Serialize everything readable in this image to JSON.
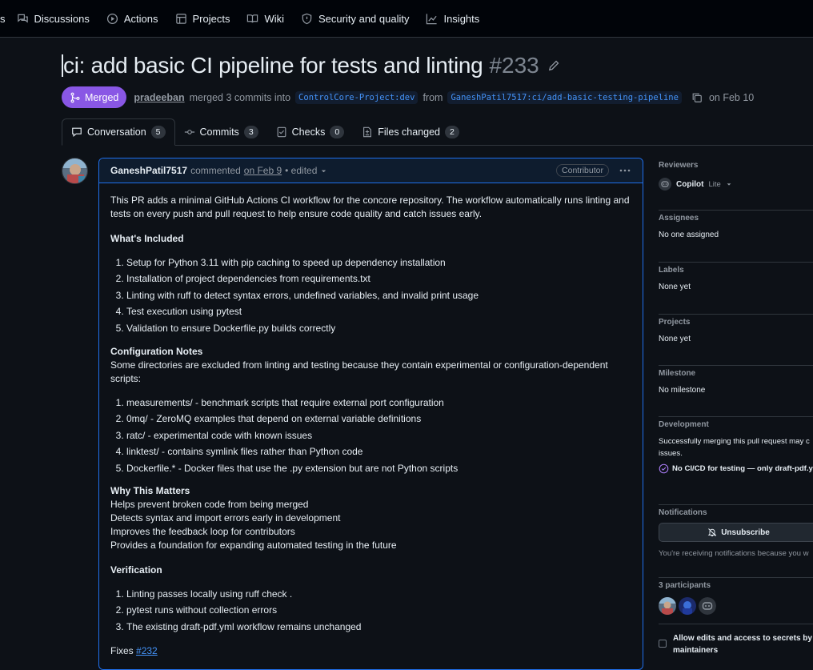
{
  "topnav": {
    "partial_label": "s",
    "items": [
      {
        "label": "Discussions",
        "icon": "discussions-icon"
      },
      {
        "label": "Actions",
        "icon": "actions-icon"
      },
      {
        "label": "Projects",
        "icon": "projects-icon"
      },
      {
        "label": "Wiki",
        "icon": "wiki-icon"
      },
      {
        "label": "Security and quality",
        "icon": "shield-icon"
      },
      {
        "label": "Insights",
        "icon": "graph-icon"
      }
    ]
  },
  "pr": {
    "title": "ci: add basic CI pipeline for tests and linting",
    "number": "#233",
    "status": "Merged",
    "merged_by": "pradeeban",
    "merge_text": "merged 3 commits into",
    "base_branch": "ControlCore-Project:dev",
    "from_text": "from",
    "head_branch": "GaneshPatil7517:ci/add-basic-testing-pipeline",
    "date": "on Feb 10"
  },
  "tabs": [
    {
      "label": "Conversation",
      "count": "5",
      "icon": "comment-icon"
    },
    {
      "label": "Commits",
      "count": "3",
      "icon": "commit-icon"
    },
    {
      "label": "Checks",
      "count": "0",
      "icon": "checks-icon"
    },
    {
      "label": "Files changed",
      "count": "2",
      "icon": "file-diff-icon"
    }
  ],
  "comment": {
    "author": "GaneshPatil7517",
    "action": "commented",
    "date": "on Feb 9",
    "edited": "• edited",
    "badge": "Contributor",
    "intro": "This PR adds a minimal GitHub Actions CI workflow for the concore repository. The workflow automatically runs linting and tests on every push and pull request to help ensure code quality and catch issues early.",
    "included_heading": "What's Included",
    "included": [
      "Setup for Python 3.11 with pip caching to speed up dependency installation",
      "Installation of project dependencies from requirements.txt",
      "Linting with ruff to detect syntax errors, undefined variables, and invalid print usage",
      "Test execution using pytest",
      "Validation to ensure Dockerfile.py builds correctly"
    ],
    "config_heading": "Configuration Notes",
    "config_intro": "Some directories are excluded from linting and testing because they contain experimental or configuration-dependent scripts:",
    "config": [
      "measurements/ - benchmark scripts that require external port configuration",
      "0mq/ - ZeroMQ examples that depend on external variable definitions",
      "ratc/ - experimental code with known issues",
      "linktest/ - contains symlink files rather than Python code",
      "Dockerfile.* - Docker files that use the .py extension but are not Python scripts"
    ],
    "why_heading": "Why This Matters",
    "why": [
      "Helps prevent broken code from being merged",
      "Detects syntax and import errors early in development",
      "Improves the feedback loop for contributors",
      "Provides a foundation for expanding automated testing in the future"
    ],
    "verify_heading": "Verification",
    "verify": [
      "Linting passes locally using ruff check .",
      "pytest runs without collection errors",
      "The existing draft-pdf.yml workflow remains unchanged"
    ],
    "fixes_label": "Fixes",
    "fixes_issue": "#232"
  },
  "sidebar": {
    "reviewers_title": "Reviewers",
    "reviewer_name": "Copilot",
    "reviewer_tag": "Lite",
    "assignees_title": "Assignees",
    "assignees_value": "No one assigned",
    "labels_title": "Labels",
    "labels_value": "None yet",
    "projects_title": "Projects",
    "projects_value": "None yet",
    "milestone_title": "Milestone",
    "milestone_value": "No milestone",
    "development_title": "Development",
    "development_text_1": "Successfully merging this pull request may c",
    "development_text_2": "issues.",
    "development_link": "No CI/CD for testing — only draft-pdf.y",
    "notifications_title": "Notifications",
    "unsubscribe_label": "Unsubscribe",
    "notifications_text": "You're receiving notifications because you w",
    "participants_title": "3 participants",
    "allow_edits_1": "Allow edits and access to secrets by",
    "allow_edits_2": "maintainers"
  },
  "colors": {
    "merged": "#8957e5",
    "link": "#4493f8",
    "bg": "#0d1117",
    "border": "#30363d"
  }
}
